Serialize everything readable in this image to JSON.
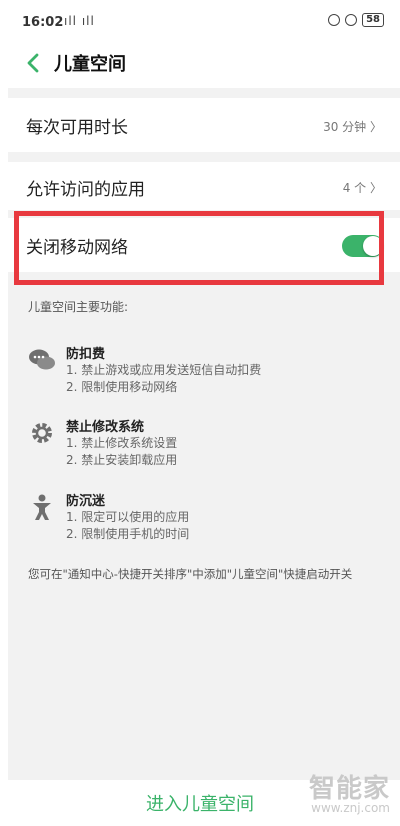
{
  "status_bar": {
    "time": "16:02",
    "signal": "ıll ıll",
    "battery": "58"
  },
  "header": {
    "title": "儿童空间"
  },
  "settings": {
    "daily_duration": {
      "label": "每次可用时长",
      "value": "30 分钟 〉"
    },
    "allowed_apps": {
      "label": "允许访问的应用",
      "value": "4 个 〉"
    },
    "mobile_network": {
      "label": "关闭移动网络",
      "enabled": true
    }
  },
  "features": {
    "section_title": "儿童空间主要功能:",
    "items": [
      {
        "name": "防扣费",
        "lines": [
          "1. 禁止游戏或应用发送短信自动扣费",
          "2. 限制使用移动网络"
        ],
        "icon": "chat-bubble-icon"
      },
      {
        "name": "禁止修改系统",
        "lines": [
          "1. 禁止修改系统设置",
          "2. 禁止安装卸载应用"
        ],
        "icon": "gear-icon"
      },
      {
        "name": "防沉迷",
        "lines": [
          "1. 限定可以使用的应用",
          "2. 限制使用手机的时间"
        ],
        "icon": "child-figure-icon"
      }
    ]
  },
  "note": "您可在\"通知中心-快捷开关排序\"中添加\"儿童空间\"快捷启动开关",
  "enter_button": "进入儿童空间",
  "watermark": {
    "main": "智能家",
    "sub": "www.znj.com"
  },
  "colors": {
    "accent": "#3bb36a",
    "highlight": "#e8393f",
    "background": "#f2f2f2"
  }
}
